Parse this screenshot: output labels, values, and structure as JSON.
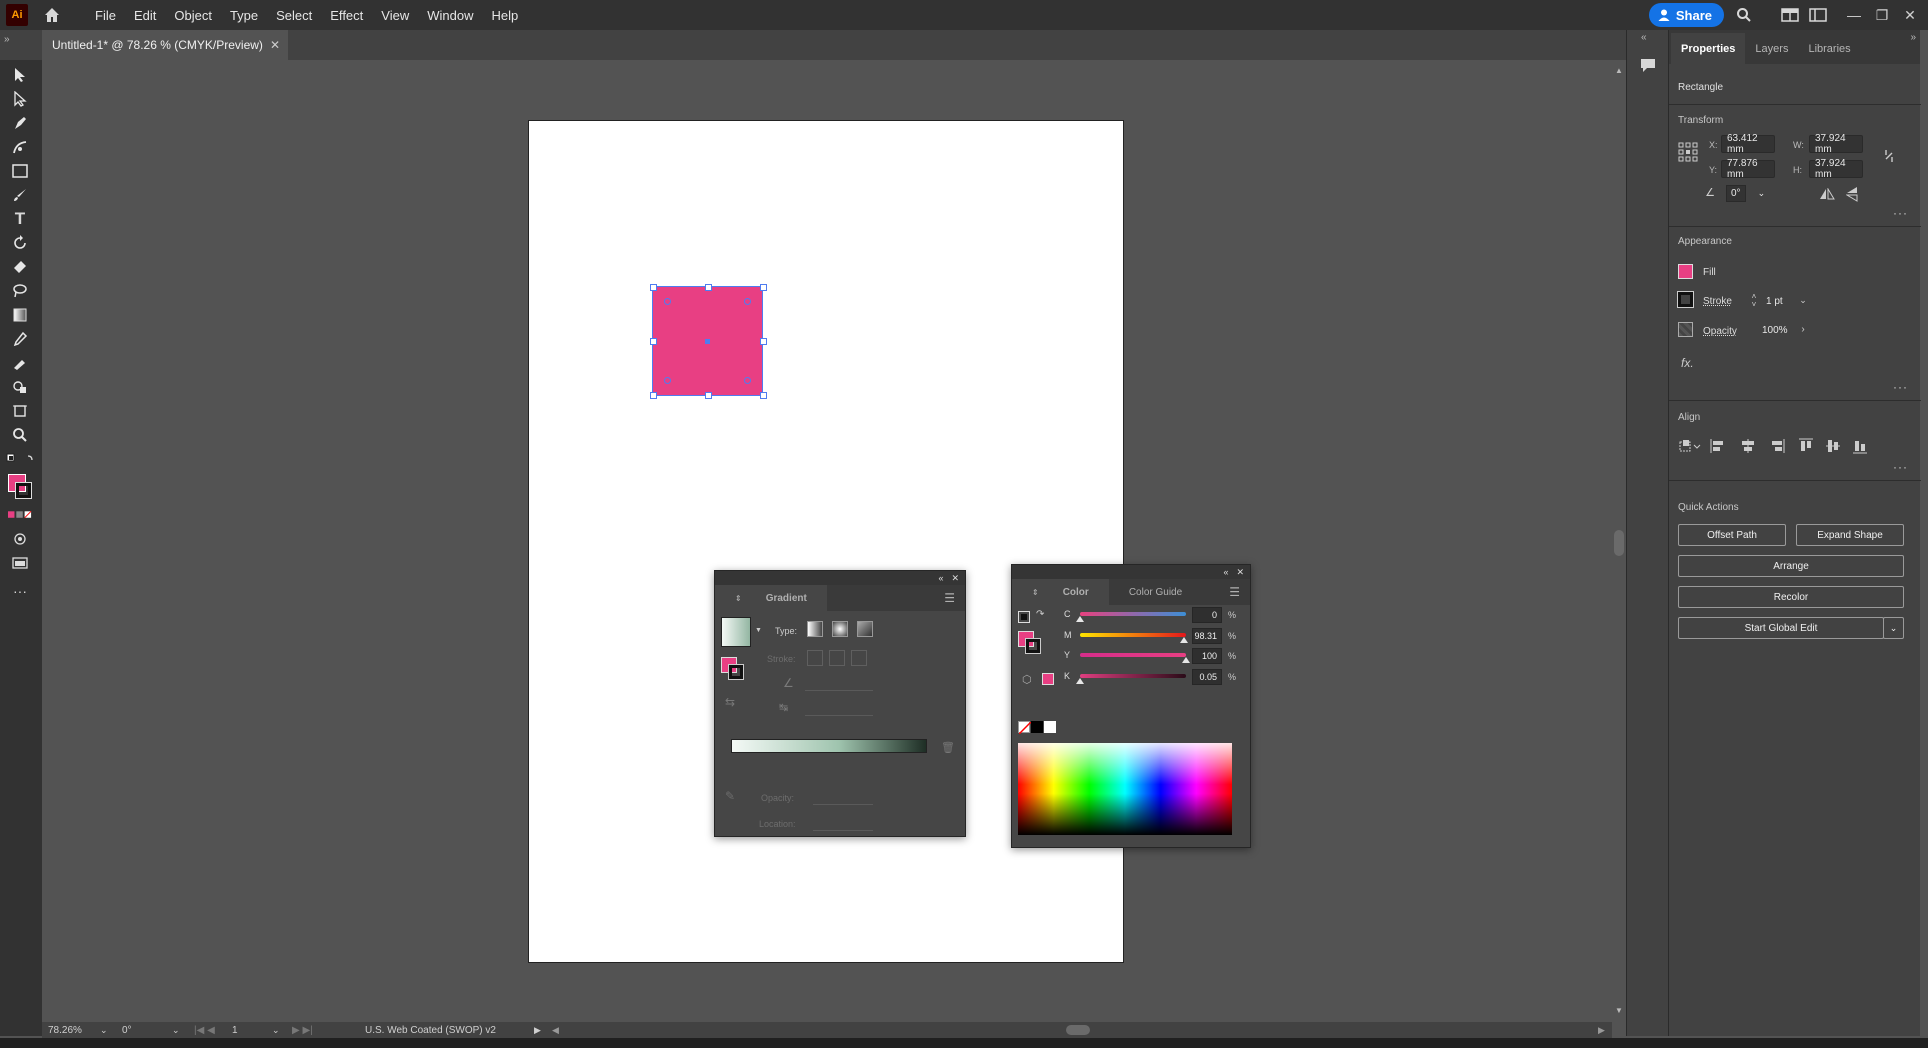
{
  "app": {
    "logo": "Ai"
  },
  "menu": [
    "File",
    "Edit",
    "Object",
    "Type",
    "Select",
    "Effect",
    "View",
    "Window",
    "Help"
  ],
  "header": {
    "share_label": "Share"
  },
  "document": {
    "tab_title": "Untitled-1* @ 78.26 % (CMYK/Preview)"
  },
  "colors": {
    "fill": "#e83f83",
    "selection": "#4f7cf0",
    "accent": "#1473e6"
  },
  "status": {
    "zoom": "78.26%",
    "rotation": "0°",
    "artboard": "1",
    "profile": "U.S. Web Coated (SWOP) v2"
  },
  "properties": {
    "tabs": [
      "Properties",
      "Layers",
      "Libraries"
    ],
    "object_type": "Rectangle",
    "transform": {
      "title": "Transform",
      "x": "63.412 mm",
      "y": "77.876 mm",
      "w": "37.924 mm",
      "h": "37.924 mm",
      "angle": "0°",
      "x_label": "X:",
      "y_label": "Y:",
      "w_label": "W:",
      "h_label": "H:"
    },
    "appearance": {
      "title": "Appearance",
      "fill_label": "Fill",
      "stroke_label": "Stroke",
      "stroke_weight": "1 pt",
      "opacity_label": "Opacity",
      "opacity_value": "100%",
      "fx": "fx."
    },
    "align": {
      "title": "Align"
    },
    "quick_actions": {
      "title": "Quick Actions",
      "offset_path": "Offset Path",
      "expand_shape": "Expand Shape",
      "arrange": "Arrange",
      "recolor": "Recolor",
      "start_global_edit": "Start Global Edit"
    }
  },
  "gradient_panel": {
    "title": "Gradient",
    "type_label": "Type:",
    "stroke_label": "Stroke:",
    "opacity_label": "Opacity:",
    "location_label": "Location:"
  },
  "color_panel": {
    "tabs": [
      "Color",
      "Color Guide"
    ],
    "channels": [
      {
        "label": "C",
        "value": "0",
        "level": 0
      },
      {
        "label": "M",
        "value": "98.31",
        "level": 0.9831
      },
      {
        "label": "Y",
        "value": "100",
        "level": 1.0
      },
      {
        "label": "K",
        "value": "0.05",
        "level": 0.0005
      }
    ],
    "unit": "%"
  }
}
